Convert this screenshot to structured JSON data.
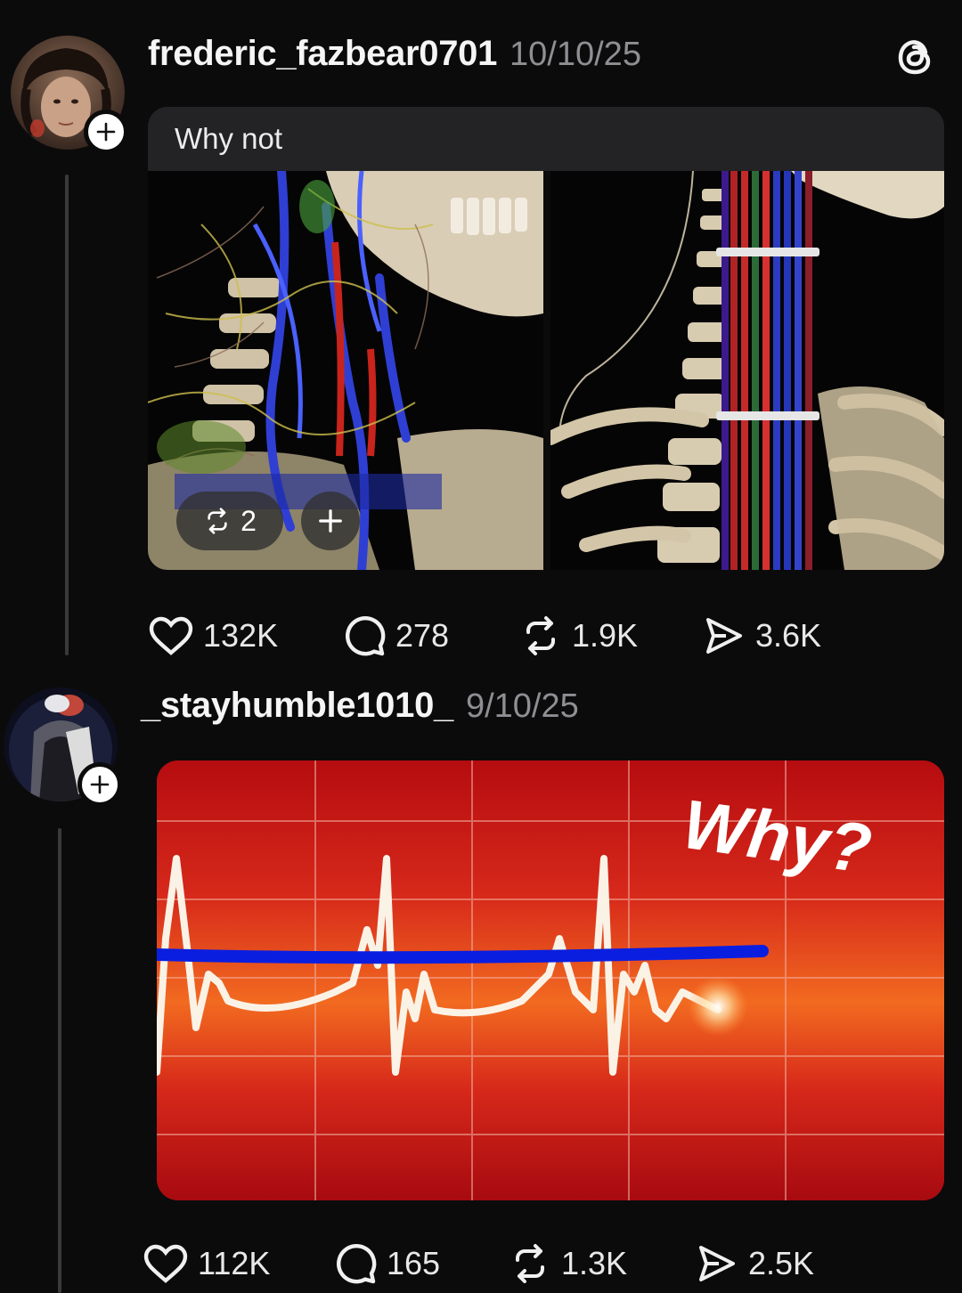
{
  "posts": [
    {
      "username": "frederic_fazbear0701",
      "date": "10/10/25",
      "caption": "Why not",
      "media_overlay": {
        "repost_count": "2"
      },
      "stats": {
        "likes": "132K",
        "comments": "278",
        "reposts": "1.9K",
        "shares": "3.6K"
      }
    },
    {
      "username": "_stayhumble1010_",
      "date": "9/10/25",
      "image_text": "Why?",
      "stats": {
        "likes": "112K",
        "comments": "165",
        "reposts": "1.3K",
        "shares": "2.5K"
      }
    }
  ],
  "icons": {
    "app_logo": "threads-icon",
    "follow": "plus-icon",
    "like": "heart-icon",
    "comment": "comment-icon",
    "repost": "repost-icon",
    "share": "send-icon"
  },
  "colors": {
    "background": "#0b0b0c",
    "muted_text": "#8e8e93",
    "ecg_red": "#c0100e",
    "ecg_blue_line": "#0a1ee0"
  }
}
